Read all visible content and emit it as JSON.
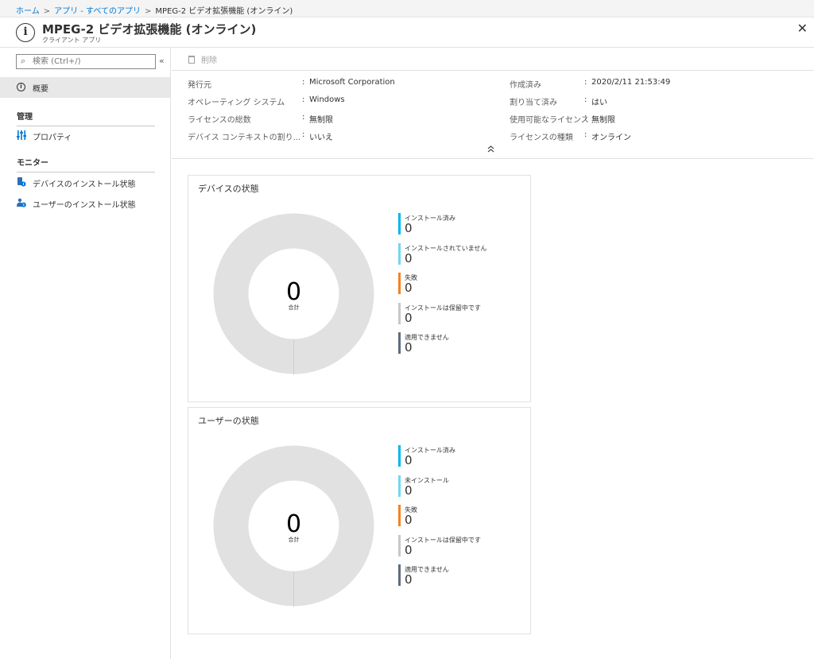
{
  "breadcrumb": {
    "home": "ホーム",
    "apps": "アプリ - すべてのアプリ",
    "current": "MPEG-2 ビデオ拡張機能 (オンライン)"
  },
  "header": {
    "title": "MPEG-2 ビデオ拡張機能 (オンライン)",
    "subtitle": "クライアント アプリ",
    "close": "✕"
  },
  "sidebar": {
    "search_placeholder": "検索 (Ctrl+/)",
    "collapse": "«",
    "overview": "概要",
    "sections": [
      {
        "heading": "管理",
        "items": [
          "プロパティ"
        ]
      },
      {
        "heading": "モニター",
        "items": [
          "デバイスのインストール状態",
          "ユーザーのインストール状態"
        ]
      }
    ]
  },
  "toolbar": {
    "delete": "削除"
  },
  "essentials": {
    "left": [
      {
        "key": "発行元",
        "value": "Microsoft Corporation"
      },
      {
        "key": "オペレーティング システム",
        "value": "Windows"
      },
      {
        "key": "ライセンスの総数",
        "value": "無制限"
      },
      {
        "key": "デバイス コンテキストの割り...",
        "value": "いいえ"
      }
    ],
    "right": [
      {
        "key": "作成済み",
        "value": "2020/2/11 21:53:49"
      },
      {
        "key": "割り当て済み",
        "value": "はい"
      },
      {
        "key": "使用可能なライセンス",
        "value": "無制限"
      },
      {
        "key": "ライセンスの種類",
        "value": "オンライン"
      }
    ]
  },
  "colors": {
    "installed": "#00b7f1",
    "not_installed": "#71d6f5",
    "failed": "#f7811c",
    "pending": "#c8c8c8",
    "not_applicable": "#5e6c7f",
    "donut": "#e1e1e1"
  },
  "device_status": {
    "title": "デバイスの状態",
    "total": "0",
    "total_label": "合計",
    "legend": [
      {
        "label": "インストール済み",
        "value": "0",
        "color": "#00b7f1"
      },
      {
        "label": "インストールされていません",
        "value": "0",
        "color": "#71d6f5"
      },
      {
        "label": "失敗",
        "value": "0",
        "color": "#f7811c"
      },
      {
        "label": "インストールは保留中です",
        "value": "0",
        "color": "#c8c8c8"
      },
      {
        "label": "適用できません",
        "value": "0",
        "color": "#5e6c7f"
      }
    ]
  },
  "user_status": {
    "title": "ユーザーの状態",
    "total": "0",
    "total_label": "合計",
    "legend": [
      {
        "label": "インストール済み",
        "value": "0",
        "color": "#00b7f1"
      },
      {
        "label": "未インストール",
        "value": "0",
        "color": "#71d6f5"
      },
      {
        "label": "失敗",
        "value": "0",
        "color": "#f7811c"
      },
      {
        "label": "インストールは保留中です",
        "value": "0",
        "color": "#c8c8c8"
      },
      {
        "label": "適用できません",
        "value": "0",
        "color": "#5e6c7f"
      }
    ]
  }
}
